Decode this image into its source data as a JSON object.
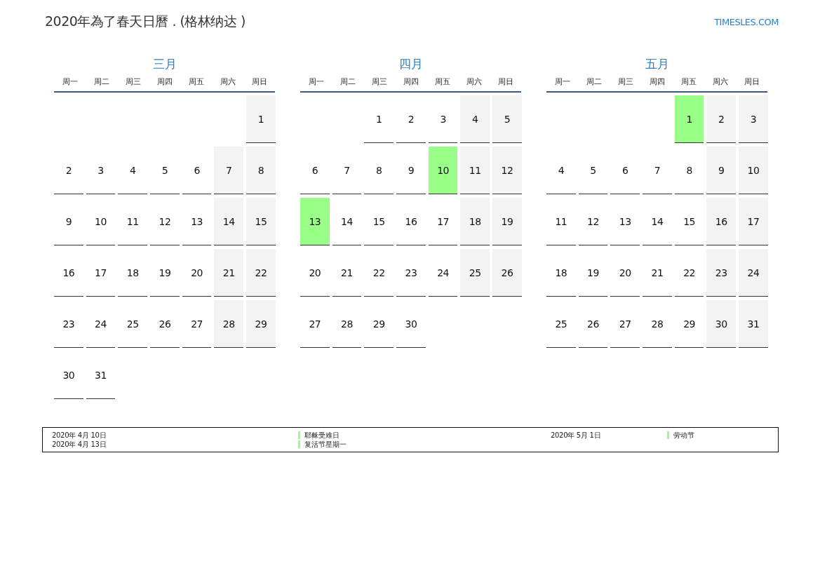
{
  "title": "2020年為了春天日曆 . (格林纳达 )",
  "brand": "TIMESLES.COM",
  "months": [
    {
      "name": "三月",
      "weekdays": [
        "周一",
        "周二",
        "周三",
        "周四",
        "周五",
        "周六",
        "周日"
      ],
      "days": [
        {
          "kind": "empty"
        },
        {
          "kind": "empty"
        },
        {
          "kind": "empty"
        },
        {
          "kind": "empty"
        },
        {
          "kind": "empty"
        },
        {
          "kind": "empty"
        },
        {
          "d": "1",
          "kind": "weekend"
        },
        {
          "d": "2",
          "kind": "weekday"
        },
        {
          "d": "3",
          "kind": "weekday"
        },
        {
          "d": "4",
          "kind": "weekday"
        },
        {
          "d": "5",
          "kind": "weekday"
        },
        {
          "d": "6",
          "kind": "weekday"
        },
        {
          "d": "7",
          "kind": "weekend"
        },
        {
          "d": "8",
          "kind": "weekend"
        },
        {
          "d": "9",
          "kind": "weekday"
        },
        {
          "d": "10",
          "kind": "weekday"
        },
        {
          "d": "11",
          "kind": "weekday"
        },
        {
          "d": "12",
          "kind": "weekday"
        },
        {
          "d": "13",
          "kind": "weekday"
        },
        {
          "d": "14",
          "kind": "weekend"
        },
        {
          "d": "15",
          "kind": "weekend"
        },
        {
          "d": "16",
          "kind": "weekday"
        },
        {
          "d": "17",
          "kind": "weekday"
        },
        {
          "d": "18",
          "kind": "weekday"
        },
        {
          "d": "19",
          "kind": "weekday"
        },
        {
          "d": "20",
          "kind": "weekday"
        },
        {
          "d": "21",
          "kind": "weekend"
        },
        {
          "d": "22",
          "kind": "weekend"
        },
        {
          "d": "23",
          "kind": "weekday"
        },
        {
          "d": "24",
          "kind": "weekday"
        },
        {
          "d": "25",
          "kind": "weekday"
        },
        {
          "d": "26",
          "kind": "weekday"
        },
        {
          "d": "27",
          "kind": "weekday"
        },
        {
          "d": "28",
          "kind": "weekend"
        },
        {
          "d": "29",
          "kind": "weekend"
        },
        {
          "d": "30",
          "kind": "weekday"
        },
        {
          "d": "31",
          "kind": "weekday"
        }
      ]
    },
    {
      "name": "四月",
      "weekdays": [
        "周一",
        "周二",
        "周三",
        "周四",
        "周五",
        "周六",
        "周日"
      ],
      "days": [
        {
          "kind": "empty"
        },
        {
          "kind": "empty"
        },
        {
          "d": "1",
          "kind": "weekday"
        },
        {
          "d": "2",
          "kind": "weekday"
        },
        {
          "d": "3",
          "kind": "weekday"
        },
        {
          "d": "4",
          "kind": "weekend"
        },
        {
          "d": "5",
          "kind": "weekend"
        },
        {
          "d": "6",
          "kind": "weekday"
        },
        {
          "d": "7",
          "kind": "weekday"
        },
        {
          "d": "8",
          "kind": "weekday"
        },
        {
          "d": "9",
          "kind": "weekday"
        },
        {
          "d": "10",
          "kind": "holiday"
        },
        {
          "d": "11",
          "kind": "weekend"
        },
        {
          "d": "12",
          "kind": "weekend"
        },
        {
          "d": "13",
          "kind": "holiday"
        },
        {
          "d": "14",
          "kind": "weekday"
        },
        {
          "d": "15",
          "kind": "weekday"
        },
        {
          "d": "16",
          "kind": "weekday"
        },
        {
          "d": "17",
          "kind": "weekday"
        },
        {
          "d": "18",
          "kind": "weekend"
        },
        {
          "d": "19",
          "kind": "weekend"
        },
        {
          "d": "20",
          "kind": "weekday"
        },
        {
          "d": "21",
          "kind": "weekday"
        },
        {
          "d": "22",
          "kind": "weekday"
        },
        {
          "d": "23",
          "kind": "weekday"
        },
        {
          "d": "24",
          "kind": "weekday"
        },
        {
          "d": "25",
          "kind": "weekend"
        },
        {
          "d": "26",
          "kind": "weekend"
        },
        {
          "d": "27",
          "kind": "weekday"
        },
        {
          "d": "28",
          "kind": "weekday"
        },
        {
          "d": "29",
          "kind": "weekday"
        },
        {
          "d": "30",
          "kind": "weekday"
        }
      ]
    },
    {
      "name": "五月",
      "weekdays": [
        "周一",
        "周二",
        "周三",
        "周四",
        "周五",
        "周六",
        "周日"
      ],
      "days": [
        {
          "kind": "empty"
        },
        {
          "kind": "empty"
        },
        {
          "kind": "empty"
        },
        {
          "kind": "empty"
        },
        {
          "d": "1",
          "kind": "holiday"
        },
        {
          "d": "2",
          "kind": "weekend"
        },
        {
          "d": "3",
          "kind": "weekend"
        },
        {
          "d": "4",
          "kind": "weekday"
        },
        {
          "d": "5",
          "kind": "weekday"
        },
        {
          "d": "6",
          "kind": "weekday"
        },
        {
          "d": "7",
          "kind": "weekday"
        },
        {
          "d": "8",
          "kind": "weekday"
        },
        {
          "d": "9",
          "kind": "weekend"
        },
        {
          "d": "10",
          "kind": "weekend"
        },
        {
          "d": "11",
          "kind": "weekday"
        },
        {
          "d": "12",
          "kind": "weekday"
        },
        {
          "d": "13",
          "kind": "weekday"
        },
        {
          "d": "14",
          "kind": "weekday"
        },
        {
          "d": "15",
          "kind": "weekday"
        },
        {
          "d": "16",
          "kind": "weekend"
        },
        {
          "d": "17",
          "kind": "weekend"
        },
        {
          "d": "18",
          "kind": "weekday"
        },
        {
          "d": "19",
          "kind": "weekday"
        },
        {
          "d": "20",
          "kind": "weekday"
        },
        {
          "d": "21",
          "kind": "weekday"
        },
        {
          "d": "22",
          "kind": "weekday"
        },
        {
          "d": "23",
          "kind": "weekend"
        },
        {
          "d": "24",
          "kind": "weekend"
        },
        {
          "d": "25",
          "kind": "weekday"
        },
        {
          "d": "26",
          "kind": "weekday"
        },
        {
          "d": "27",
          "kind": "weekday"
        },
        {
          "d": "28",
          "kind": "weekday"
        },
        {
          "d": "29",
          "kind": "weekday"
        },
        {
          "d": "30",
          "kind": "weekend"
        },
        {
          "d": "31",
          "kind": "weekend"
        }
      ]
    }
  ],
  "legend": [
    {
      "entries": [
        {
          "date": "2020年 4月 10日",
          "name": "耶稣受难日",
          "color": "#99ff88"
        },
        {
          "date": "2020年 4月 13日",
          "name": "复活节星期一",
          "color": "#99ff88"
        }
      ]
    },
    {
      "entries": [
        {
          "date": "2020年 5月 1日",
          "name": "劳动节",
          "color": "#99ff88"
        }
      ]
    }
  ]
}
